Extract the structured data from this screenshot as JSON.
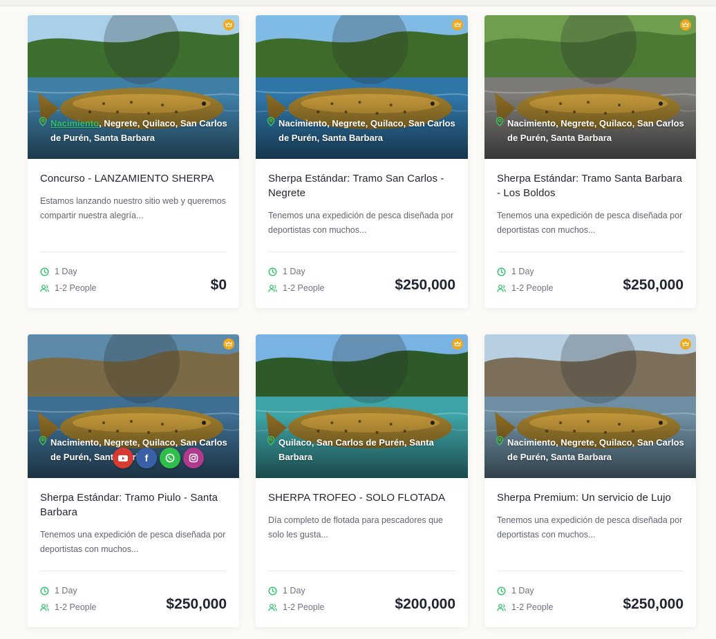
{
  "cards": [
    {
      "location_first": "Nacimiento",
      "location_rest": ", Negrete, Quilaco, San Carlos de Purén, Santa Barbara",
      "location_highlight": true,
      "title": "Concurso - LANZAMIENTO SHERPA",
      "description": "Estamos lanzando nuestro sitio web y queremos compartir nuestra alegría...",
      "duration": "1 Day",
      "people": "1-2 People",
      "price": "$0",
      "sky": "#a9cfe9",
      "water": "#3f7fa6",
      "bank": "#3d6f2f"
    },
    {
      "location_first": "Nacimiento",
      "location_rest": ", Negrete, Quilaco, San Carlos de Purén, Santa Barbara",
      "location_highlight": false,
      "title": "Sherpa Estándar: Tramo San Carlos - Negrete",
      "description": "Tenemos una expedición de pesca diseñada por deportistas con muchos...",
      "duration": "1 Day",
      "people": "1-2 People",
      "price": "$250,000",
      "sky": "#7fbbe4",
      "water": "#2f76a8",
      "bank": "#3f6b2a"
    },
    {
      "location_first": "Nacimiento",
      "location_rest": ", Negrete, Quilaco, San Carlos de Purén, Santa Barbara",
      "location_highlight": false,
      "title": "Sherpa Estándar: Tramo Santa Barbara - Los Boldos",
      "description": "Tenemos una expedición de pesca diseñada por deportistas con muchos...",
      "duration": "1 Day",
      "people": "1-2 People",
      "price": "$250,000",
      "sky": "#6f9e4f",
      "water": "#7b7a76",
      "bank": "#4c7a35"
    },
    {
      "location_first": "Nacimiento",
      "location_rest": ", Negrete, Quilaco, San Carlos de Purén, Santa Barbara",
      "location_highlight": false,
      "title": "Sherpa Estándar: Tramo Piulo - Santa Barbara",
      "description": "Tenemos una expedición de pesca diseñada por deportistas con muchos...",
      "duration": "1 Day",
      "people": "1-2 People",
      "price": "$250,000",
      "sky": "#5d8aa8",
      "water": "#3e6f93",
      "bank": "#7a6a45"
    },
    {
      "location_first": "Quilaco",
      "location_rest": ", San Carlos de Purén, Santa Barbara",
      "location_highlight": false,
      "title": "SHERPA TROFEO - SOLO FLOTADA",
      "description": "Día completo de flotada para pescadores que solo les gusta...",
      "duration": "1 Day",
      "people": "1-2 People",
      "price": "$200,000",
      "sky": "#79b3e3",
      "water": "#3da3a6",
      "bank": "#2e5a2a"
    },
    {
      "location_first": "Nacimiento",
      "location_rest": ", Negrete, Quilaco, San Carlos de Purén, Santa Barbara",
      "location_highlight": false,
      "title": "Sherpa Premium: Un servicio de Lujo",
      "description": "Tenemos una expedición de pesca diseñada por deportistas con muchos...",
      "duration": "1 Day",
      "people": "1-2 People",
      "price": "$250,000",
      "sky": "#b7cfe0",
      "water": "#6e8fa3",
      "bank": "#7b6e5a"
    }
  ],
  "social": {
    "youtube": "You",
    "facebook": "f"
  },
  "colors": {
    "accent_green": "#2ec36b",
    "crown_badge": "#f2a81d",
    "price_text": "#1f2430"
  }
}
